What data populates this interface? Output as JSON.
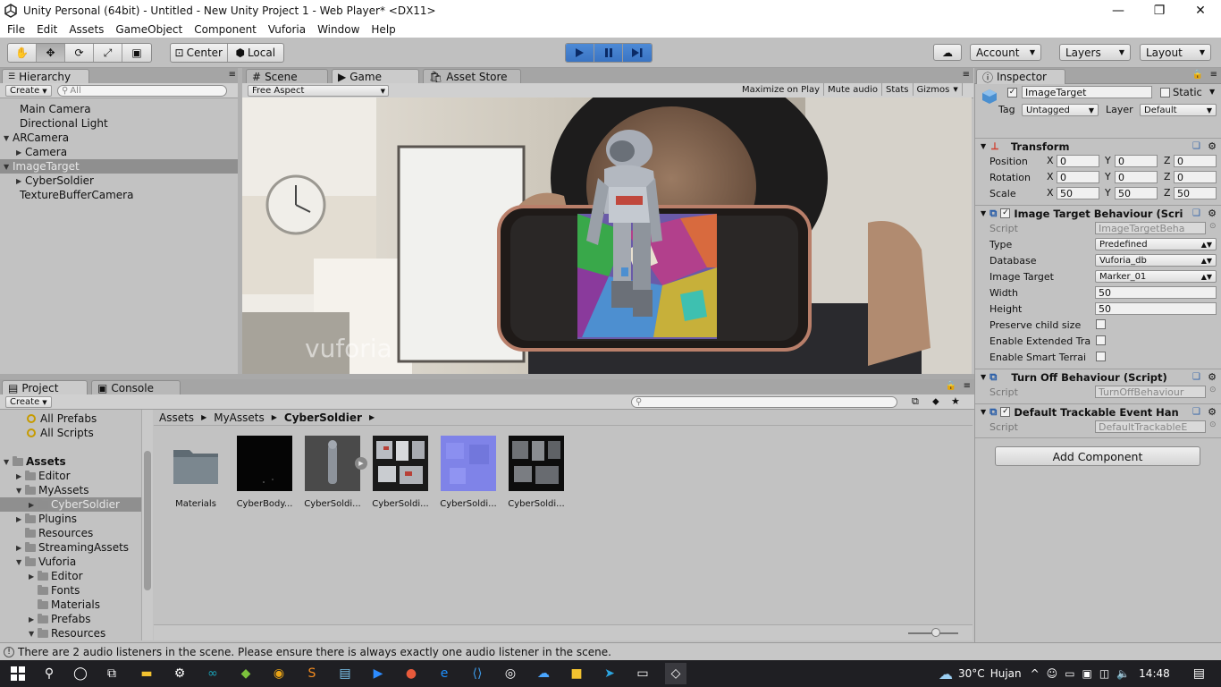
{
  "window": {
    "title": "Unity Personal (64bit) - Untitled - New Unity Project 1 - Web Player* <DX11>",
    "minimize": "—",
    "maximize": "❐",
    "close": "✕"
  },
  "menu": [
    "File",
    "Edit",
    "Assets",
    "GameObject",
    "Component",
    "Vuforia",
    "Window",
    "Help"
  ],
  "toolbar": {
    "pivot": "Center",
    "space": "Local",
    "account": "Account",
    "layers": "Layers",
    "layout": "Layout",
    "play_state": "playing"
  },
  "hierarchy": {
    "tab": "Hierarchy",
    "create": "Create",
    "search_placeholder": "All",
    "items": [
      {
        "label": "Main Camera",
        "indent": 0,
        "expander": ""
      },
      {
        "label": "Directional Light",
        "indent": 0,
        "expander": ""
      },
      {
        "label": "ARCamera",
        "indent": 0,
        "expander": "▼"
      },
      {
        "label": "Camera",
        "indent": 1,
        "expander": "▶"
      },
      {
        "label": "ImageTarget",
        "indent": 0,
        "expander": "▼",
        "selected": true
      },
      {
        "label": "CyberSoldier",
        "indent": 1,
        "expander": "▶"
      },
      {
        "label": "TextureBufferCamera",
        "indent": 0,
        "expander": ""
      }
    ]
  },
  "center_tabs": {
    "scene": "Scene",
    "game": "Game",
    "asset_store": "Asset Store"
  },
  "game": {
    "aspect": "Free Aspect",
    "buttons": [
      "Maximize on Play",
      "Mute audio",
      "Stats",
      "Gizmos"
    ],
    "watermark": "vuforia"
  },
  "project": {
    "tab": "Project",
    "console_tab": "Console",
    "create": "Create",
    "favorites": [
      "All Prefabs",
      "All Scripts"
    ],
    "tree": [
      {
        "label": "Assets",
        "indent": 0,
        "expander": "▼",
        "bold": true
      },
      {
        "label": "Editor",
        "indent": 1,
        "expander": "▶"
      },
      {
        "label": "MyAssets",
        "indent": 1,
        "expander": "▼"
      },
      {
        "label": "CyberSoldier",
        "indent": 2,
        "expander": "▶",
        "selected": true
      },
      {
        "label": "Plugins",
        "indent": 1,
        "expander": "▶"
      },
      {
        "label": "Resources",
        "indent": 1,
        "expander": ""
      },
      {
        "label": "StreamingAssets",
        "indent": 1,
        "expander": "▶"
      },
      {
        "label": "Vuforia",
        "indent": 1,
        "expander": "▼"
      },
      {
        "label": "Editor",
        "indent": 2,
        "expander": "▶"
      },
      {
        "label": "Fonts",
        "indent": 2,
        "expander": ""
      },
      {
        "label": "Materials",
        "indent": 2,
        "expander": ""
      },
      {
        "label": "Prefabs",
        "indent": 2,
        "expander": "▶"
      },
      {
        "label": "Resources",
        "indent": 2,
        "expander": "▼"
      }
    ],
    "breadcrumb": [
      "Assets",
      "MyAssets",
      "CyberSoldier"
    ],
    "assets": [
      {
        "label": "Materials",
        "kind": "folder"
      },
      {
        "label": "CyberBody...",
        "kind": "black"
      },
      {
        "label": "CyberSoldi...",
        "kind": "model"
      },
      {
        "label": "CyberSoldi...",
        "kind": "texture"
      },
      {
        "label": "CyberSoldi...",
        "kind": "normal"
      },
      {
        "label": "CyberSoldi...",
        "kind": "dark"
      }
    ]
  },
  "inspector": {
    "tab": "Inspector",
    "object_name": "ImageTarget",
    "static_label": "Static",
    "tag_label": "Tag",
    "tag_value": "Untagged",
    "layer_label": "Layer",
    "layer_value": "Default",
    "transform": {
      "title": "Transform",
      "position_label": "Position",
      "rotation_label": "Rotation",
      "scale_label": "Scale",
      "position": [
        "0",
        "0",
        "0"
      ],
      "rotation": [
        "0",
        "0",
        "0"
      ],
      "scale": [
        "50",
        "50",
        "50"
      ],
      "x": "X",
      "y": "Y",
      "z": "Z"
    },
    "image_target": {
      "title": "Image Target Behaviour (Scri",
      "script_label": "Script",
      "script_value": "ImageTargetBeha",
      "type_label": "Type",
      "type_value": "Predefined",
      "database_label": "Database",
      "database_value": "Vuforia_db",
      "target_label": "Image Target",
      "target_value": "Marker_01",
      "width_label": "Width",
      "width_value": "50",
      "height_label": "Height",
      "height_value": "50",
      "preserve_label": "Preserve child size",
      "extended_label": "Enable Extended Tra",
      "smart_label": "Enable Smart Terrai"
    },
    "turn_off": {
      "title": "Turn Off Behaviour (Script)",
      "script_label": "Script",
      "script_value": "TurnOffBehaviour"
    },
    "trackable": {
      "title": "Default Trackable Event Han",
      "script_label": "Script",
      "script_value": "DefaultTrackableE"
    },
    "add_component": "Add Component"
  },
  "status": {
    "message": "There are 2 audio listeners in the scene. Please ensure there is always exactly one audio listener in the scene."
  },
  "taskbar": {
    "temperature": "30°C",
    "weather": "Hujan",
    "time": "14:48"
  }
}
